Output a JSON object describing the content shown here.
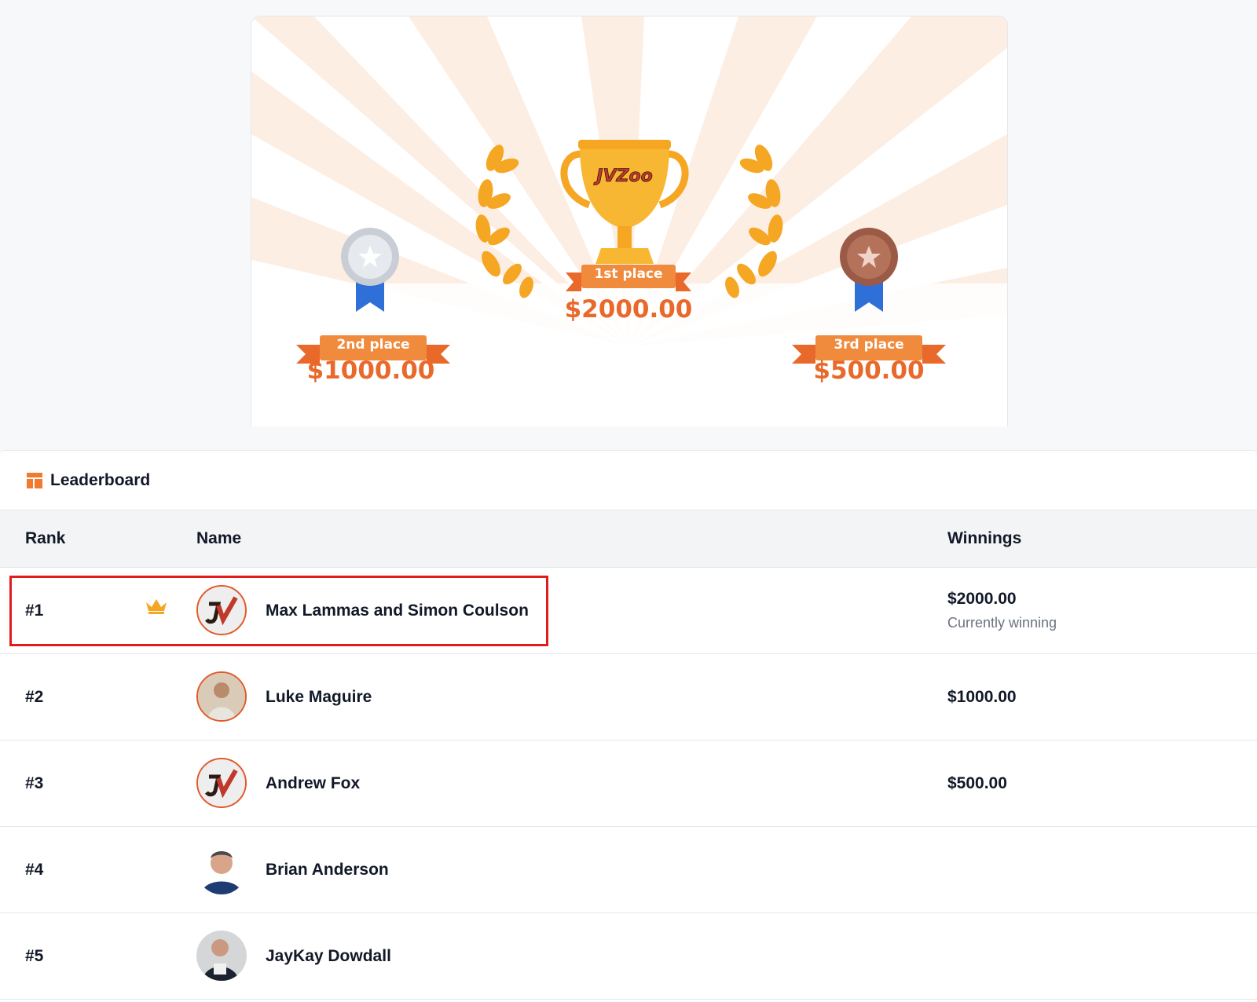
{
  "prizes": {
    "first": {
      "label": "1st place",
      "amount": "$2000.00"
    },
    "second": {
      "label": "2nd place",
      "amount": "$1000.00"
    },
    "third": {
      "label": "3rd place",
      "amount": "$500.00"
    },
    "trophy_logo": "JVZoo"
  },
  "leaderboard": {
    "title": "Leaderboard",
    "columns": {
      "rank": "Rank",
      "name": "Name",
      "winnings": "Winnings"
    },
    "rows": [
      {
        "rank": "#1",
        "name": "Max Lammas and Simon Coulson",
        "winnings": "$2000.00",
        "status": "Currently winning",
        "avatar": "jvzoo-logo",
        "crown": true
      },
      {
        "rank": "#2",
        "name": "Luke Maguire",
        "winnings": "$1000.00",
        "avatar": "photo"
      },
      {
        "rank": "#3",
        "name": "Andrew Fox",
        "winnings": "$500.00",
        "avatar": "jvzoo-logo"
      },
      {
        "rank": "#4",
        "name": "Brian Anderson",
        "winnings": "",
        "avatar": "photo"
      },
      {
        "rank": "#5",
        "name": "JayKay Dowdall",
        "winnings": "",
        "avatar": "photo"
      }
    ]
  },
  "colors": {
    "accent": "#f07a2e",
    "highlight": "#e41b1b",
    "gold": "#f5a623"
  }
}
